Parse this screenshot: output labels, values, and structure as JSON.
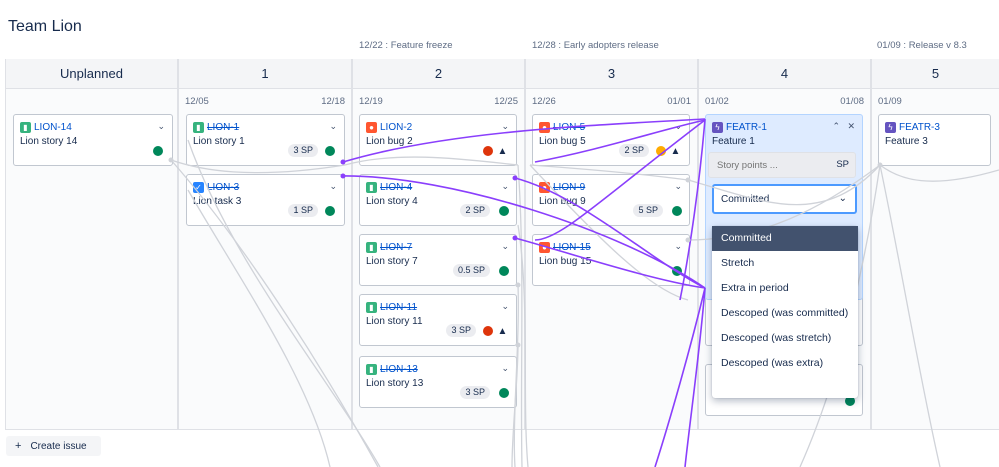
{
  "team_title": "Team Lion",
  "milestones": [
    {
      "label": "12/22 : Feature freeze"
    },
    {
      "label": "12/28 : Early adopters release"
    },
    {
      "label": "01/09 : Release v 8.3"
    }
  ],
  "columns": [
    {
      "name": "Unplanned",
      "start": "",
      "end": ""
    },
    {
      "name": "1",
      "start": "12/05",
      "end": "12/18"
    },
    {
      "name": "2",
      "start": "12/19",
      "end": "12/25"
    },
    {
      "name": "3",
      "start": "12/26",
      "end": "01/01"
    },
    {
      "name": "4",
      "start": "01/02",
      "end": "01/08"
    },
    {
      "name": "5",
      "start": "01/09",
      "end": ""
    }
  ],
  "cards": [
    {
      "key": "LION-14",
      "title": "Lion story 14",
      "type": "story",
      "done": false,
      "sp": "",
      "status": "green"
    },
    {
      "key": "LION-1",
      "title": "Lion story 1",
      "type": "story",
      "done": true,
      "sp": "3 SP",
      "status": "green"
    },
    {
      "key": "LION-3",
      "title": "Lion task 3",
      "type": "task",
      "done": true,
      "sp": "1 SP",
      "status": "green"
    },
    {
      "key": "LION-2",
      "title": "Lion bug 2",
      "type": "bug",
      "done": false,
      "sp": "",
      "status": "red",
      "warning": true
    },
    {
      "key": "LION-4",
      "title": "Lion story 4",
      "type": "story",
      "done": true,
      "sp": "2 SP",
      "status": "green"
    },
    {
      "key": "LION-7",
      "title": "Lion story 7",
      "type": "story",
      "done": true,
      "sp": "0.5 SP",
      "status": "green"
    },
    {
      "key": "LION-11",
      "title": "Lion story 11",
      "type": "story",
      "done": true,
      "sp": "3 SP",
      "status": "red",
      "warning": true
    },
    {
      "key": "LION-13",
      "title": "Lion story 13",
      "type": "story",
      "done": true,
      "sp": "3 SP",
      "status": "green"
    },
    {
      "key": "LION-5",
      "title": "Lion bug 5",
      "type": "bug",
      "done": true,
      "sp": "2 SP",
      "status": "orange",
      "warning": true
    },
    {
      "key": "LION-9",
      "title": "Lion bug 9",
      "type": "bug",
      "done": true,
      "sp": "5 SP",
      "status": "green"
    },
    {
      "key": "LION-15",
      "title": "Lion bug 15",
      "type": "bug",
      "done": true,
      "sp": "",
      "status": "green"
    },
    {
      "key": "FEATR-1",
      "title": "Feature 1",
      "type": "feature",
      "done": false,
      "sp": "",
      "status": ""
    },
    {
      "key": "FEATR-3",
      "title": "Feature 3",
      "type": "feature",
      "done": false,
      "sp": "",
      "status": ""
    }
  ],
  "editor": {
    "story_points_placeholder": "Story points ...",
    "story_points_unit": "SP",
    "commitment_value": "Committed",
    "options": [
      "Committed",
      "Stretch",
      "Extra in period",
      "Descoped (was committed)",
      "Descoped (was stretch)",
      "Descoped (was extra)"
    ]
  },
  "create_issue_label": "Create issue",
  "colors": {
    "link_active": "#8a3ffc",
    "link_inactive": "#d0d3d9",
    "accent": "#0052cc"
  }
}
